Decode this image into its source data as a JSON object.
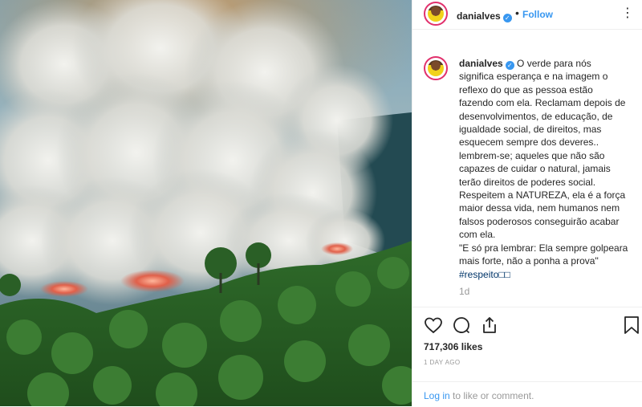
{
  "post": {
    "username": "danialves",
    "verified_mark": "✓",
    "separator": "•",
    "follow_label": "Follow",
    "more_label": "⋮",
    "caption_lines": [
      "O verde para nós",
      "significa esperança e na imagem o",
      "reflexo do que as pessoa estão",
      "fazendo com ela. Reclamam depois de",
      "desenvolvimentos, de educação, de",
      "igualdade social, de direitos, mas",
      "esquecem sempre dos deveres..",
      "lembrem-se; aqueles que não são",
      "capazes de cuidar o natural, jamais",
      "terão direitos de poderes social.",
      "Respeitem a NATUREZA, ela é a força",
      "maior dessa vida, nem humanos nem",
      "falsos poderosos conseguirão acabar",
      "com ela.",
      "\"E só pra lembrar: Ela sempre golpeara",
      "mais forte, não a ponha a prova\""
    ],
    "hashtag": "#respeito□□",
    "time_ago": "1d",
    "likes": "717,306 likes",
    "date": "1 DAY AGO",
    "login_link": "Log in",
    "login_rest": " to like or comment."
  },
  "icons": {
    "like": "heart-icon",
    "comment": "comment-icon",
    "share": "share-icon",
    "save": "bookmark-icon"
  },
  "colors": {
    "accent": "#3897f0",
    "hashtag": "#003569",
    "muted": "#999999",
    "text": "#262626"
  }
}
